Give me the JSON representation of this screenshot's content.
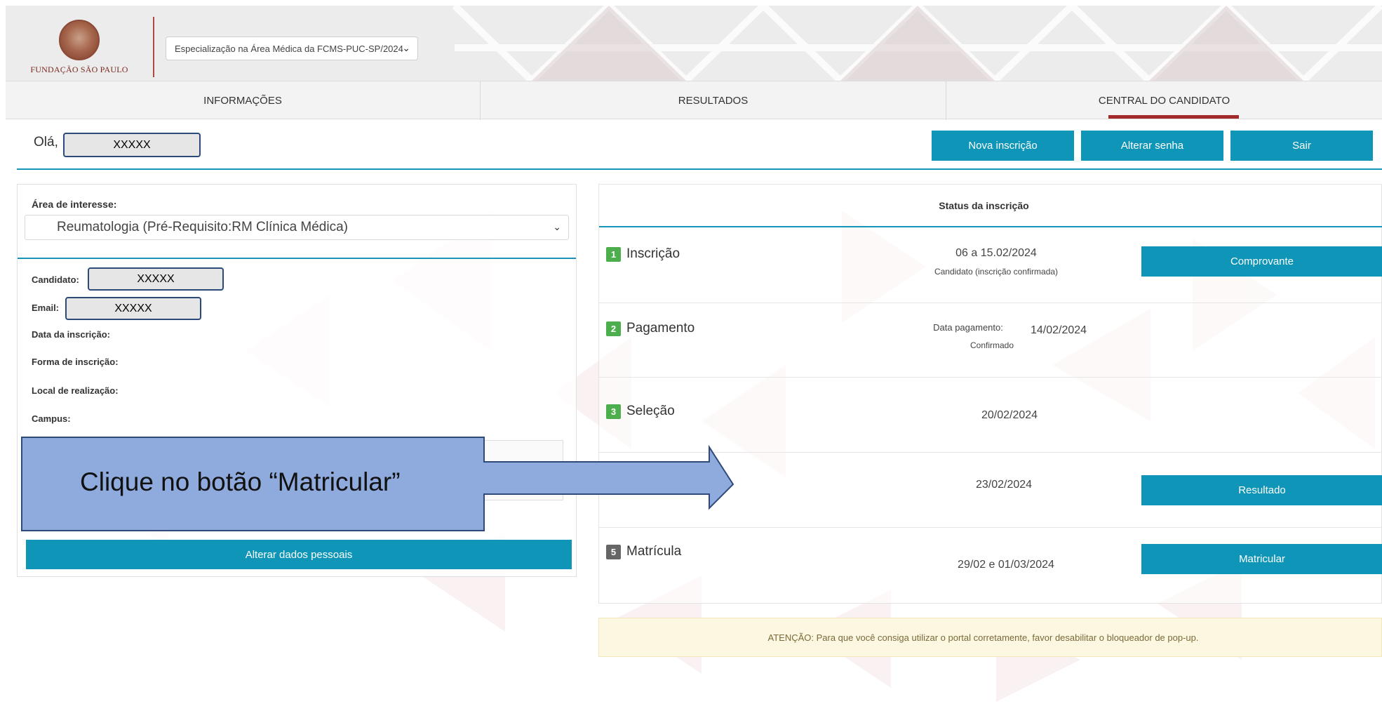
{
  "header": {
    "logo_text": "FUNDAÇÃO SÃO PAULO",
    "edition_select": "Especialização na Área Médica da FCMS-PUC-SP/2024"
  },
  "nav": {
    "tabs": [
      {
        "label": "INFORMAÇÕES",
        "active": false
      },
      {
        "label": "RESULTADOS",
        "active": false
      },
      {
        "label": "CENTRAL DO CANDIDATO",
        "active": true
      }
    ]
  },
  "greeting": {
    "prefix": "Olá,",
    "name": "XXXXX"
  },
  "actions": {
    "new_registration": "Nova inscrição",
    "change_password": "Alterar senha",
    "logout": "Sair"
  },
  "profile": {
    "area_label": "Área de interesse:",
    "area_value": "Reumatologia (Pré-Requisito:RM Clínica Médica)",
    "fields": {
      "candidate_label": "Candidato:",
      "candidate_value": "XXXXX",
      "email_label": "Email:",
      "email_value": "XXXXX",
      "registration_date_label": "Data da inscrição:",
      "registration_form_label": "Forma de inscrição:",
      "location_label": "Local de realização:",
      "campus_label": "Campus:"
    },
    "edit_button": "Alterar dados pessoais"
  },
  "status": {
    "title": "Status da inscrição",
    "steps": [
      {
        "number": "1",
        "label": "Inscrição",
        "date": "06 a 15.02/2024",
        "note": "Candidato (inscrição confirmada)",
        "button": "Comprovante"
      },
      {
        "number": "2",
        "label": "Pagamento",
        "date_label": "Data pagamento:",
        "date": "14/02/2024",
        "note": "Confirmado"
      },
      {
        "number": "3",
        "label": "Seleção",
        "date": "20/02/2024"
      },
      {
        "date": "23/02/2024",
        "button": "Resultado"
      },
      {
        "number": "5",
        "label": "Matrícula",
        "date": "29/02 e 01/03/2024",
        "button": "Matricular"
      }
    ]
  },
  "alert": {
    "text": "ATENÇÃO: Para que você consiga utilizar o portal corretamente, favor desabilitar o bloqueador de pop-up."
  },
  "callout": {
    "text": "Clique no botão “Matricular”"
  },
  "colors": {
    "accent": "#0f95b7",
    "brand_red": "#a32a2a",
    "step_green": "#4cae4c",
    "step_gray": "#666666",
    "callout_fill": "#8faadc",
    "callout_border": "#2f4a7a"
  }
}
